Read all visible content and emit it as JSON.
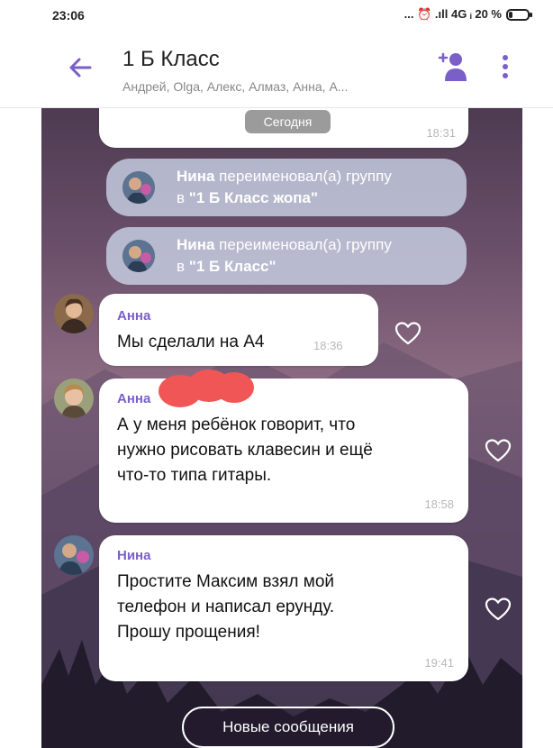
{
  "status_bar": {
    "time": "23:06",
    "icons_text": "... ⏰ .ıll 4G ᵢ 20 %",
    "battery_level_percent": 20
  },
  "header": {
    "title": "1 Б Класс",
    "members": "Андрей, Olga, Алекс, Алмаз, Анна, А..."
  },
  "date_pill": "Сегодня",
  "first_message": {
    "time": "18:31"
  },
  "system_messages": [
    {
      "actor": "Нина",
      "action": " переименовал(а) группу",
      "prefix": "в ",
      "name": "\"1 Б Класс жопа\""
    },
    {
      "actor": "Нина",
      "action": " переименовал(а) группу",
      "prefix": "в ",
      "name": "\"1 Б Класс\""
    }
  ],
  "messages": [
    {
      "sender": "Анна",
      "lines": [
        "Мы сделали на А4"
      ],
      "time": "18:36"
    },
    {
      "sender": "Анна",
      "lines": [
        "А у меня ребёнок говорит, что",
        "нужно рисовать клавесин и ещё",
        "что-то типа гитары."
      ],
      "time": "18:58"
    },
    {
      "sender": "Нина",
      "lines": [
        "Простите Максим взял мой",
        "телефон и написал ерунду.",
        "Прошу прощения!"
      ],
      "time": "19:41"
    }
  ],
  "new_messages_button": "Новые сообщения",
  "colors": {
    "accent": "#7a5fc8",
    "bubble": "#ffffff",
    "redaction": "#f05656"
  }
}
